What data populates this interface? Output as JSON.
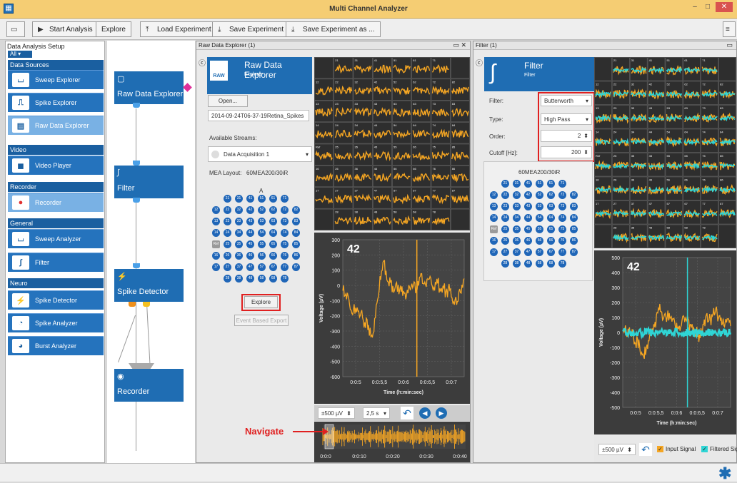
{
  "window": {
    "title": "Multi Channel Analyzer",
    "app_icon": "grid-app-icon",
    "controls": [
      "–",
      "□",
      "✕"
    ]
  },
  "toolbar": {
    "start": "Start Analysis",
    "explore": "Explore",
    "load": "Load Experiment",
    "save": "Save Experiment",
    "save_as": "Save Experiment as ..."
  },
  "left": {
    "header": "Data Analysis Setup",
    "filter": "All",
    "categories": {
      "data_sources": "Data Sources",
      "video": "Video",
      "recorder": "Recorder",
      "general": "General",
      "neuro": "Neuro"
    },
    "items": {
      "sweep_explorer": "Sweep Explorer",
      "spike_explorer": "Spike Explorer",
      "raw_data_explorer": "Raw Data Explorer",
      "video_player": "Video Player",
      "recorder": "Recorder",
      "sweep_analyzer": "Sweep Analyzer",
      "filter": "Filter",
      "spike_detector": "Spike Detector",
      "spike_analyzer": "Spike Analyzer",
      "burst_analyzer": "Burst Analyzer"
    }
  },
  "flow": {
    "raw": "Raw Data Explorer",
    "filter": "Filter",
    "spike": "Spike Detector",
    "recorder": "Recorder"
  },
  "raw": {
    "pane_title": "Raw Data Explorer (1)",
    "tile_title": "Raw Data Explorer",
    "tile_sub": "Explorer",
    "tile_icon": "RAW",
    "open": "Open...",
    "filename": "2014-09-24T06-37-19Retina_Spikes",
    "streams_label": "Available Streams:",
    "stream": "Data Acquisition 1",
    "layout_label": "MEA Layout:",
    "layout": "60MEA200/30iR",
    "layout_col": "A",
    "explore_btn": "Explore",
    "event_btn": "Event Based Export",
    "grid_labels": [
      "21",
      "31",
      "41",
      "51",
      "61",
      "71",
      "12",
      "22",
      "32",
      "42",
      "52",
      "62",
      "72",
      "82",
      "13",
      "23",
      "33",
      "43",
      "53",
      "63",
      "73",
      "83",
      "14",
      "24",
      "34",
      "44",
      "54",
      "64",
      "74",
      "84",
      "Ref",
      "25",
      "35",
      "45",
      "55",
      "65",
      "75",
      "85",
      "16",
      "26",
      "36",
      "46",
      "56",
      "66",
      "76",
      "86",
      "17",
      "27",
      "37",
      "47",
      "57",
      "67",
      "77",
      "87",
      "28",
      "38",
      "48",
      "58",
      "68",
      "78"
    ],
    "channel": "42",
    "y_ticks": [
      "300",
      "200",
      "100",
      "0",
      "-100",
      "-200",
      "-300",
      "-400",
      "-500",
      "-600"
    ],
    "y_label": "Voltage (µV)",
    "x_ticks": [
      "0:0:5",
      "0:0:5,5",
      "0:0:6",
      "0:0:6,5",
      "0:0:7"
    ],
    "x_label": "Time (h:min:sec)",
    "range": "±500 µV",
    "window": "2,5 s",
    "nav_ticks": [
      "0:0:0",
      "0:0:10",
      "0:0:20",
      "0:0:30",
      "0:0:40"
    ],
    "annotation": "Navigate"
  },
  "filter": {
    "pane_title": "Filter (1)",
    "tile_title": "Filter",
    "tile_sub": "Filter",
    "filter_label": "Filter:",
    "filter_value": "Butterworth",
    "type_label": "Type:",
    "type_value": "High Pass",
    "order_label": "Order:",
    "order_value": "2",
    "cutoff_label": "Cutoff [Hz]:",
    "cutoff_value": "200",
    "layout": "60MEA200/30iR",
    "channel": "42",
    "y_ticks": [
      "500",
      "400",
      "300",
      "200",
      "100",
      "0",
      "-100",
      "-200",
      "-300",
      "-400",
      "-500"
    ],
    "y_label": "Voltage (µV)",
    "x_ticks": [
      "0:0:5",
      "0:0:5,5",
      "0:0:6",
      "0:0:6,5",
      "0:0:7"
    ],
    "x_label": "Time (h:min:sec)",
    "range": "±500 µV",
    "input_signal": "Input Signal",
    "filtered": "Filtered Sig"
  },
  "colors": {
    "accent": "#1f6db3",
    "trace_raw": "#f5a623",
    "trace_filtered": "#2fd5d5",
    "highlight": "#e02020"
  }
}
